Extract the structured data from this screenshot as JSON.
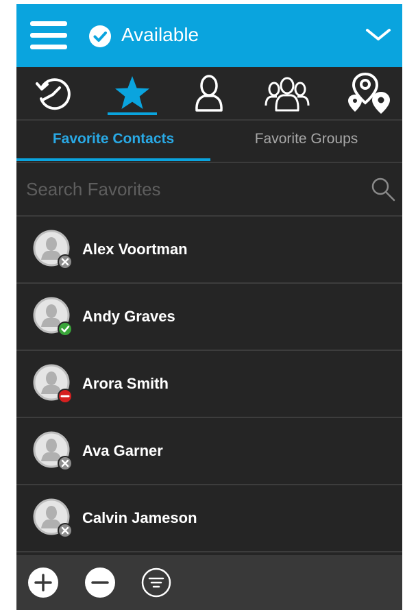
{
  "header": {
    "status_label": "Available",
    "accent_color": "#0aa4de"
  },
  "nav_icons": [
    {
      "name": "recent-history-icon",
      "active": false
    },
    {
      "name": "favorites-star-icon",
      "active": true
    },
    {
      "name": "contact-icon",
      "active": false
    },
    {
      "name": "groups-icon",
      "active": false
    },
    {
      "name": "map-location-icon",
      "active": false
    }
  ],
  "tabs": [
    {
      "label": "Favorite Contacts",
      "active": true
    },
    {
      "label": "Favorite Groups",
      "active": false
    }
  ],
  "search": {
    "placeholder": "Search Favorites",
    "value": ""
  },
  "contacts": [
    {
      "name": "Alex Voortman",
      "presence": "offline"
    },
    {
      "name": "Andy Graves",
      "presence": "available"
    },
    {
      "name": "Arora Smith",
      "presence": "do-not-disturb"
    },
    {
      "name": "Ava Garner",
      "presence": "offline"
    },
    {
      "name": "Calvin Jameson",
      "presence": "offline"
    }
  ],
  "presence_colors": {
    "offline": "#8c8c8c",
    "available": "#3aa53a",
    "do-not-disturb": "#d62020"
  },
  "bottom_actions": [
    {
      "name": "add-icon"
    },
    {
      "name": "remove-icon"
    },
    {
      "name": "filter-icon"
    }
  ]
}
